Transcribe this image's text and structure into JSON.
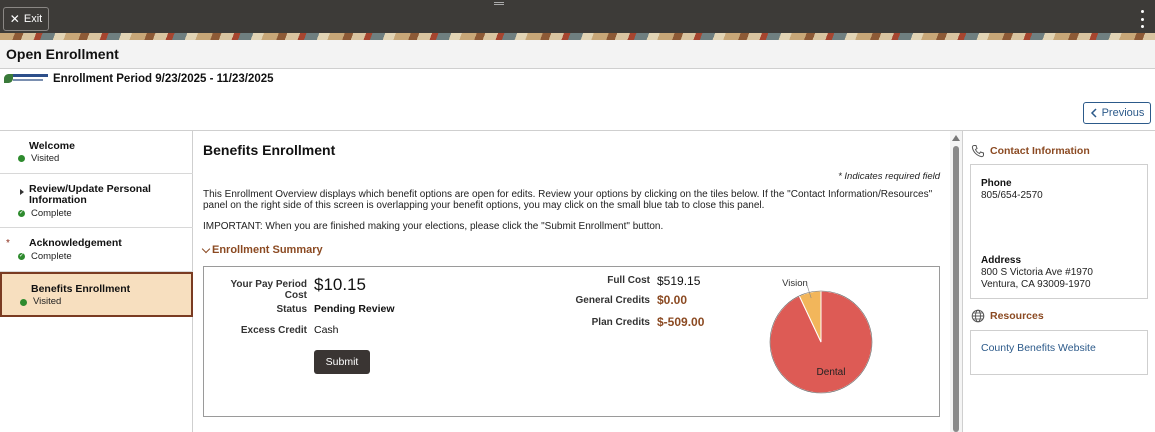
{
  "header": {
    "exit_label": "Exit",
    "page_title": "Open Enrollment",
    "enrollment_period": "Enrollment Period 9/23/2025 - 11/23/2025",
    "previous_label": "Previous"
  },
  "nav": {
    "items": [
      {
        "label": "Welcome",
        "status": "Visited"
      },
      {
        "label": "Review/Update Personal Information",
        "status": "Complete"
      },
      {
        "label": "Acknowledgement",
        "status": "Complete",
        "required_mark": "*"
      },
      {
        "label": "Benefits Enrollment",
        "status": "Visited"
      }
    ]
  },
  "main": {
    "title": "Benefits Enrollment",
    "required_note": "* Indicates required field",
    "intro": "This Enrollment Overview displays which benefit options are open for edits. Review your options by clicking on the tiles below. If the \"Contact Information/Resources\" panel on the right side of this screen is overlapping your benefit options, you may click on the small blue tab to close this panel.",
    "important": "IMPORTANT: When you are finished making your elections, please click the \"Submit Enrollment\" button.",
    "summary_heading": "Enrollment Summary",
    "summary": {
      "pay_period_cost_label": "Your Pay Period Cost",
      "pay_period_cost": "$10.15",
      "status_label": "Status",
      "status": "Pending Review",
      "excess_credit_label": "Excess Credit",
      "excess_credit": "Cash",
      "submit_label": "Submit",
      "full_cost_label": "Full Cost",
      "full_cost": "$519.15",
      "general_credits_label": "General Credits",
      "general_credits": "$0.00",
      "plan_credits_label": "Plan Credits",
      "plan_credits": "$-509.00"
    }
  },
  "chart_data": {
    "type": "pie",
    "labels": [
      "Dental",
      "Vision"
    ],
    "values": [
      93,
      7
    ],
    "colors": [
      "#dd5b55",
      "#f2b65b"
    ]
  },
  "right_panel": {
    "contact_heading": "Contact Information",
    "phone_label": "Phone",
    "phone": "805/654-2570",
    "address_label": "Address",
    "address_line1": "800 S Victoria Ave #1970",
    "address_line2": "Ventura, CA 93009-1970",
    "resources_heading": "Resources",
    "resource_link": "County Benefits Website"
  }
}
